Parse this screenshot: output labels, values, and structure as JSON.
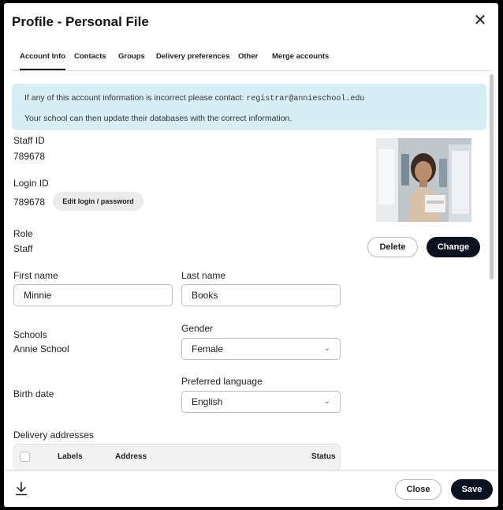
{
  "title": "Profile - Personal File",
  "tabs": [
    {
      "label": "Account Info",
      "active": true
    },
    {
      "label": "Contacts"
    },
    {
      "label": "Groups"
    },
    {
      "label": "Delivery preferences"
    },
    {
      "label": "Other"
    },
    {
      "label": "Merge accounts"
    }
  ],
  "notice": {
    "line1_prefix": "If any of this account information is incorrect please contact:",
    "email": "registrar@annieschool.edu",
    "line2": "Your school can then update their databases with the correct information."
  },
  "staff_id": {
    "label": "Staff ID",
    "value": "789678"
  },
  "login_id": {
    "label": "Login ID",
    "value": "789678",
    "edit_label": "Edit login / password"
  },
  "role": {
    "label": "Role",
    "value": "Staff"
  },
  "photo_actions": {
    "delete_label": "Delete",
    "change_label": "Change"
  },
  "first_name": {
    "label": "First name",
    "value": "Minnie"
  },
  "last_name": {
    "label": "Last name",
    "value": "Books"
  },
  "schools": {
    "label": "Schools",
    "value": "Annie School"
  },
  "gender": {
    "label": "Gender",
    "value": "Female"
  },
  "birth_date": {
    "label": "Birth date"
  },
  "preferred_language": {
    "label": "Preferred language",
    "value": "English"
  },
  "delivery_addresses": {
    "label": "Delivery addresses",
    "columns": [
      "Labels",
      "Address",
      "Status"
    ]
  },
  "footer": {
    "close_label": "Close",
    "save_label": "Save"
  },
  "icons": {
    "close": "close-icon",
    "download": "download-icon",
    "chevron": "chevron-down-icon"
  }
}
